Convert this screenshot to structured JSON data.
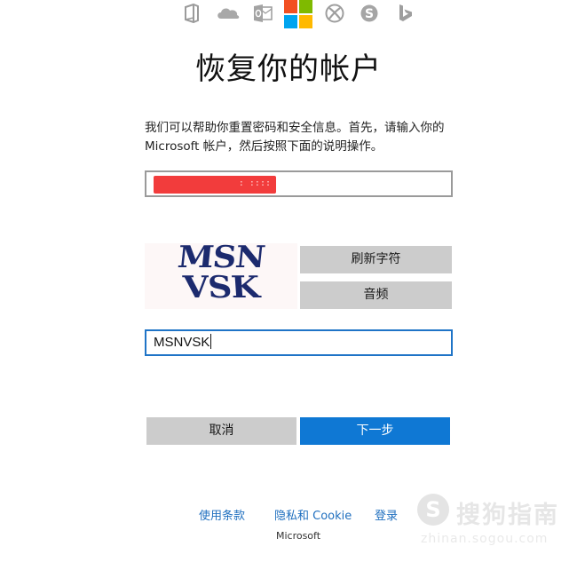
{
  "top_icons": [
    {
      "name": "office-icon"
    },
    {
      "name": "onedrive-icon"
    },
    {
      "name": "outlook-icon"
    },
    {
      "name": "microsoft-logo"
    },
    {
      "name": "xbox-icon"
    },
    {
      "name": "skype-icon"
    },
    {
      "name": "bing-icon"
    }
  ],
  "colors": {
    "ms_red": "#f25022",
    "ms_green": "#7fba00",
    "ms_blue": "#00a4ef",
    "ms_yellow": "#ffb900",
    "primary_button": "#0f78d4",
    "secondary_button": "#cccccc",
    "link": "#1f6fbf",
    "redaction": "#f23c3c"
  },
  "page": {
    "title": "恢复你的帐户",
    "description": "我们可以帮助你重置密码和安全信息。首先，请输入你的 Microsoft 帐户，然后按照下面的说明操作。"
  },
  "account_field": {
    "value_redacted": true,
    "visible_fragment": ": ::::"
  },
  "captcha": {
    "line1": "MSN",
    "line2": "VSK",
    "refresh_label": "刷新字符",
    "audio_label": "音频",
    "input_value": "MSNVSK"
  },
  "actions": {
    "cancel_label": "取消",
    "next_label": "下一步"
  },
  "footer": {
    "terms": "使用条款",
    "privacy": "隐私和 Cookie",
    "signin": "登录",
    "brand": "Microsoft"
  },
  "watermark": {
    "glyph": "S",
    "text": "搜狗指南",
    "domain": "zhinan.sogou.com"
  }
}
